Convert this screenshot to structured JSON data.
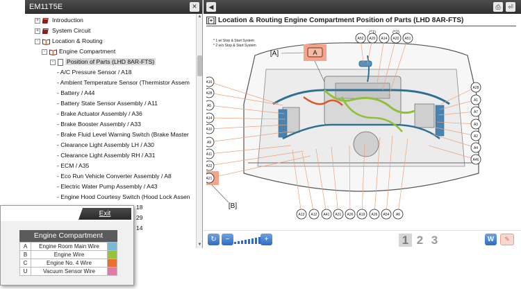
{
  "left_pane": {
    "title": "EM11T5E",
    "close_label": "×",
    "tree": [
      {
        "label": "Introduction",
        "indent": 0,
        "type": "book",
        "expander": "+"
      },
      {
        "label": "System Circuit",
        "indent": 0,
        "type": "book",
        "expander": "+"
      },
      {
        "label": "Location & Routing",
        "indent": 0,
        "type": "book-open",
        "expander": "−"
      },
      {
        "label": "Engine Compartment",
        "indent": 1,
        "type": "book-open",
        "expander": "−"
      },
      {
        "label": "Position of Parts (LHD 8AR-FTS)",
        "indent": 2,
        "type": "doc",
        "expander": "−",
        "selected": true
      },
      {
        "label": "- A/C Pressure Sensor / A18",
        "indent": 3,
        "type": "leaf"
      },
      {
        "label": "- Ambient Temperature Sensor (Thermistor Assem",
        "indent": 3,
        "type": "leaf"
      },
      {
        "label": "- Battery / A44",
        "indent": 3,
        "type": "leaf"
      },
      {
        "label": "- Battery State Sensor Assembly / A11",
        "indent": 3,
        "type": "leaf"
      },
      {
        "label": "- Brake Actuator Assembly / A36",
        "indent": 3,
        "type": "leaf"
      },
      {
        "label": "- Brake Booster Assembly / A33",
        "indent": 3,
        "type": "leaf"
      },
      {
        "label": "- Brake Fluid Level Warning Switch (Brake Master",
        "indent": 3,
        "type": "leaf"
      },
      {
        "label": "- Clearance Light Assembly LH / A30",
        "indent": 3,
        "type": "leaf"
      },
      {
        "label": "- Clearance Light Assembly RH / A31",
        "indent": 3,
        "type": "leaf"
      },
      {
        "label": "- ECM / A35",
        "indent": 3,
        "type": "leaf"
      },
      {
        "label": "- Eco Run Vehicle Converter Assembly / A8",
        "indent": 3,
        "type": "leaf"
      },
      {
        "label": "- Electric Water Pump Assembly / A43",
        "indent": 3,
        "type": "leaf"
      },
      {
        "label": "- Engine Hood Courtesy Switch (Hood Lock Assen",
        "indent": 3,
        "type": "leaf"
      },
      {
        "label": "18",
        "indent": 3,
        "type": "partial"
      },
      {
        "label": "29",
        "indent": 3,
        "type": "partial"
      },
      {
        "label": "14",
        "indent": 3,
        "type": "partial"
      }
    ]
  },
  "right_pane": {
    "title_prefix": "[+]",
    "title": "Location & Routing  Engine Compartment  Position of Parts (LHD 8AR-FTS)",
    "notes": [
      "* 1 w/ Stop & Start System",
      "* 2 w/o Stop & Start System"
    ],
    "callout_A_label": "[A]",
    "callout_A_box": "A",
    "callout_B_label": "[B]",
    "star_labels": [
      "(*1)",
      "(*2)"
    ],
    "top_connectors": [
      "A52",
      "A20",
      "A14",
      "A20",
      "A51"
    ],
    "left_connectors": [
      "A16",
      "A28",
      "A5",
      "A14",
      "A10",
      "A9",
      "A11",
      "A22",
      "A21"
    ],
    "right_connectors": [
      "A28",
      "A1",
      "A7",
      "A3",
      "A2",
      "A4",
      "A46"
    ],
    "bottom_connectors": [
      "A13",
      "A12",
      "A41",
      "A31",
      "A26",
      "A19",
      "A26",
      "A54",
      "A6"
    ],
    "page_numbers": [
      "1",
      "2",
      "3"
    ],
    "active_page": "1",
    "w_button": "W",
    "comment_icon": "comment-icon"
  },
  "popup": {
    "exit_label": "Exit",
    "legend_title": "Engine Compartment",
    "rows": [
      {
        "letter": "A",
        "name": "Engine Room Main Wire",
        "color": "#7ab8d9"
      },
      {
        "letter": "B",
        "name": "Engine Wire",
        "color": "#98c23c"
      },
      {
        "letter": "C",
        "name": "Engine No. 4 Wire",
        "color": "#e8722d"
      },
      {
        "letter": "U",
        "name": "Vacuum Sensor Wire",
        "color": "#e07aa8"
      }
    ]
  },
  "colors": {
    "header_dark": "#3a3a3a",
    "orange_leader": "#f0a078",
    "highlight_box": "#f2a58c",
    "wire_blue": "#2e6f93",
    "wire_green": "#8fc03a",
    "wire_orange": "#d9592a"
  }
}
